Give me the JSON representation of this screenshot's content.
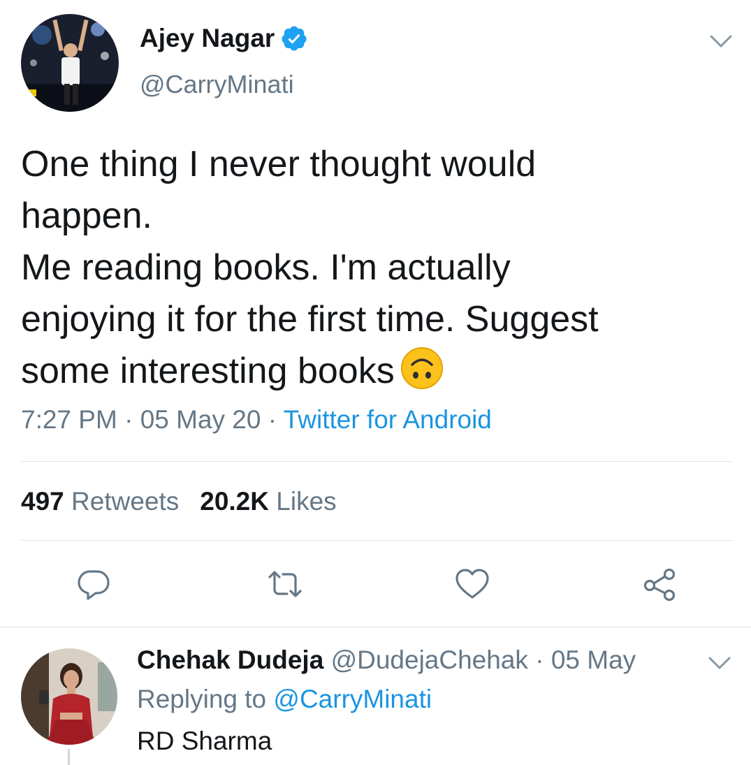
{
  "tweet": {
    "author_name": "Ajey Nagar",
    "author_handle": "@CarryMinati",
    "verified": true,
    "text_lines": [
      "One thing I never thought would",
      "happen.",
      "Me reading books. I'm actually",
      "enjoying it for the first time. Suggest",
      "some interesting books"
    ],
    "emoji": "upside-down-face-icon",
    "time": "7:27 PM",
    "date": "05 May 20",
    "separator": "·",
    "source": "Twitter for Android",
    "retweets_count": "497",
    "retweets_label": "Retweets",
    "likes_count": "20.2K",
    "likes_label": "Likes"
  },
  "actions": {
    "reply": "reply-icon",
    "retweet": "retweet-icon",
    "like": "heart-icon",
    "share": "share-icon"
  },
  "reply": {
    "author_name": "Chehak Dudeja",
    "author_handle": "@DudejaChehak",
    "separator": "·",
    "date": "05 May",
    "replying_prefix": "Replying to",
    "replying_to": "@CarryMinati",
    "text": "RD Sharma"
  },
  "colors": {
    "accent": "#1b95e0",
    "text_primary": "#14171a",
    "text_secondary": "#657786",
    "divider": "#dfe3e6"
  }
}
